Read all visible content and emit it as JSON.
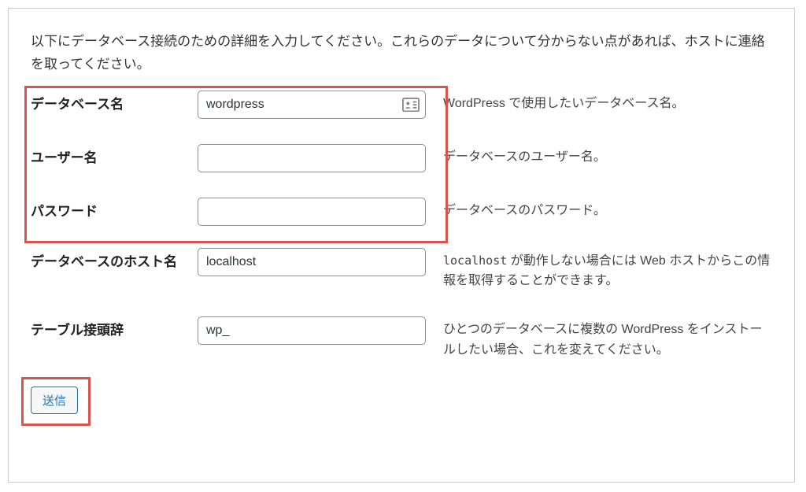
{
  "intro": "以下にデータベース接続のための詳細を入力してください。これらのデータについて分からない点があれば、ホストに連絡を取ってください。",
  "fields": {
    "dbname": {
      "label": "データベース名",
      "value": "wordpress",
      "desc": "WordPress で使用したいデータベース名。"
    },
    "username": {
      "label": "ユーザー名",
      "value": "",
      "desc": "データベースのユーザー名。"
    },
    "password": {
      "label": "パスワード",
      "value": "",
      "desc": "データベースのパスワード。"
    },
    "dbhost": {
      "label": "データベースのホスト名",
      "value": "localhost",
      "desc_prefix": "localhost",
      "desc_rest": " が動作しない場合には Web ホストからこの情報を取得することができます。"
    },
    "prefix": {
      "label": "テーブル接頭辞",
      "value": "wp_",
      "desc": "ひとつのデータベースに複数の WordPress をインストールしたい場合、これを変えてください。"
    }
  },
  "submit_label": "送信"
}
